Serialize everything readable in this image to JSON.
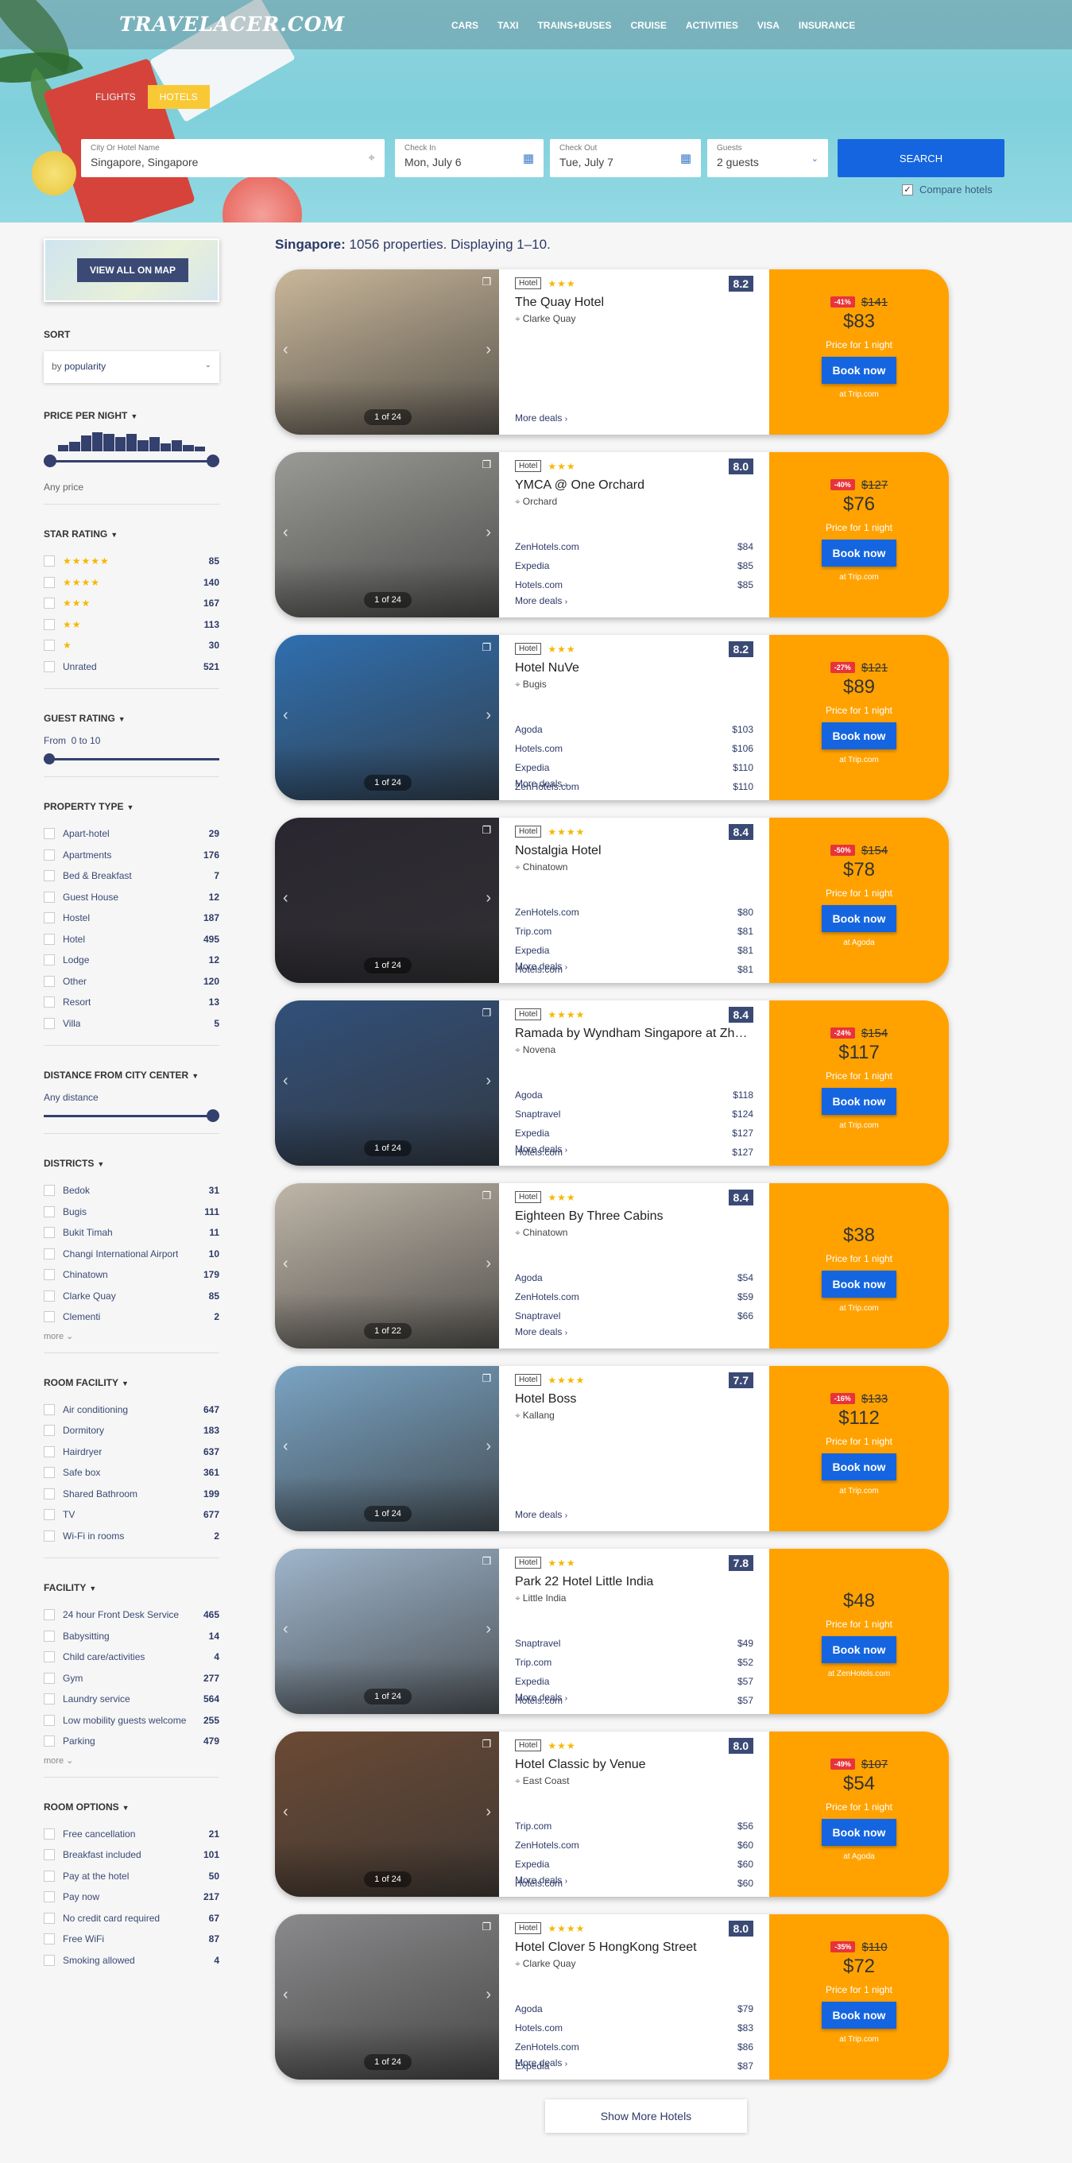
{
  "header": {
    "logo": "TRAVELACER.COM",
    "nav": [
      "CARS",
      "TAXI",
      "TRAINS+BUSES",
      "CRUISE",
      "ACTIVITIES",
      "VISA",
      "INSURANCE"
    ],
    "tabs": [
      "FLIGHTS",
      "HOTELS"
    ]
  },
  "search": {
    "city_label": "City Or Hotel Name",
    "city_value": "Singapore, Singapore",
    "checkin_label": "Check In",
    "checkin_value": "Mon, July 6",
    "checkout_label": "Check Out",
    "checkout_value": "Tue, July 7",
    "guests_label": "Guests",
    "guests_value": "2 guests",
    "search_button": "SEARCH",
    "compare_label": "Compare hotels",
    "compare_checked": true
  },
  "sidebar": {
    "map_button": "VIEW ALL ON MAP",
    "sort_title": "SORT",
    "sort_prefix": "by",
    "sort_value": "popularity",
    "price_title": "PRICE PER NIGHT",
    "price_value": "Any price",
    "star_title": "STAR RATING",
    "stars": [
      {
        "stars": "★★★★★",
        "count": "85"
      },
      {
        "stars": "★★★★",
        "count": "140"
      },
      {
        "stars": "★★★",
        "count": "167"
      },
      {
        "stars": "★★",
        "count": "113"
      },
      {
        "stars": "★",
        "count": "30"
      },
      {
        "label": "Unrated",
        "count": "521"
      }
    ],
    "guest_title": "GUEST RATING",
    "guest_from": "From",
    "guest_range": "0 to 10",
    "property_title": "PROPERTY TYPE",
    "property": [
      {
        "label": "Apart-hotel",
        "count": "29"
      },
      {
        "label": "Apartments",
        "count": "176"
      },
      {
        "label": "Bed & Breakfast",
        "count": "7"
      },
      {
        "label": "Guest House",
        "count": "12"
      },
      {
        "label": "Hostel",
        "count": "187"
      },
      {
        "label": "Hotel",
        "count": "495"
      },
      {
        "label": "Lodge",
        "count": "12"
      },
      {
        "label": "Other",
        "count": "120"
      },
      {
        "label": "Resort",
        "count": "13"
      },
      {
        "label": "Villa",
        "count": "5"
      }
    ],
    "distance_title": "DISTANCE FROM CITY CENTER",
    "distance_value": "Any distance",
    "districts_title": "DISTRICTS",
    "districts": [
      {
        "label": "Bedok",
        "count": "31"
      },
      {
        "label": "Bugis",
        "count": "111"
      },
      {
        "label": "Bukit Timah",
        "count": "11"
      },
      {
        "label": "Changi International Airport",
        "count": "10"
      },
      {
        "label": "Chinatown",
        "count": "179"
      },
      {
        "label": "Clarke Quay",
        "count": "85"
      },
      {
        "label": "Clementi",
        "count": "2"
      }
    ],
    "more": "more ⌄",
    "room_facility_title": "ROOM FACILITY",
    "room_facility": [
      {
        "label": "Air conditioning",
        "count": "647"
      },
      {
        "label": "Dormitory",
        "count": "183"
      },
      {
        "label": "Hairdryer",
        "count": "637"
      },
      {
        "label": "Safe box",
        "count": "361"
      },
      {
        "label": "Shared Bathroom",
        "count": "199"
      },
      {
        "label": "TV",
        "count": "677"
      },
      {
        "label": "Wi-Fi in rooms",
        "count": "2"
      }
    ],
    "facility_title": "FACILITY",
    "facility": [
      {
        "label": "24 hour Front Desk Service",
        "count": "465"
      },
      {
        "label": "Babysitting",
        "count": "14"
      },
      {
        "label": "Child care/activities",
        "count": "4"
      },
      {
        "label": "Gym",
        "count": "277"
      },
      {
        "label": "Laundry service",
        "count": "564"
      },
      {
        "label": "Low mobility guests welcome",
        "count": "255"
      },
      {
        "label": "Parking",
        "count": "479"
      }
    ],
    "room_options_title": "ROOM OPTIONS",
    "room_options": [
      {
        "label": "Free cancellation",
        "count": "21"
      },
      {
        "label": "Breakfast included",
        "count": "101"
      },
      {
        "label": "Pay at the hotel",
        "count": "50"
      },
      {
        "label": "Pay now",
        "count": "217"
      },
      {
        "label": "No credit card required",
        "count": "67"
      },
      {
        "label": "Free WiFi",
        "count": "87"
      },
      {
        "label": "Smoking allowed",
        "count": "4"
      }
    ]
  },
  "results": {
    "city": "Singapore:",
    "summary": "1056 properties. Displaying 1–10.",
    "more_deals": "More deals",
    "price_for": "Price for 1 night",
    "book": "Book now",
    "hotel_tag": "Hotel",
    "show_more": "Show More Hotels",
    "hotels": [
      {
        "name": "The Quay Hotel",
        "stars": "★★★",
        "score": "8.2",
        "district": "Clarke Quay",
        "photos": "1 of 24",
        "discount": "-41%",
        "old": "$141",
        "price": "$83",
        "at": "at Trip.com",
        "deals": [],
        "color": "#c9b79a"
      },
      {
        "name": "YMCA @ One Orchard",
        "stars": "★★★",
        "score": "8.0",
        "district": "Orchard",
        "photos": "1 of 24",
        "discount": "-40%",
        "old": "$127",
        "price": "$76",
        "at": "at Trip.com",
        "deals": [
          [
            "ZenHotels.com",
            "$84"
          ],
          [
            "Expedia",
            "$85"
          ],
          [
            "Hotels.com",
            "$85"
          ]
        ],
        "color": "#9a9a96"
      },
      {
        "name": "Hotel NuVe",
        "stars": "★★★",
        "score": "8.2",
        "district": "Bugis",
        "photos": "1 of 24",
        "discount": "-27%",
        "old": "$121",
        "price": "$89",
        "at": "at Trip.com",
        "deals": [
          [
            "Agoda",
            "$103"
          ],
          [
            "Hotels.com",
            "$106"
          ],
          [
            "Expedia",
            "$110"
          ],
          [
            "ZenHotels.com",
            "$110"
          ]
        ],
        "color": "#2f6fb0"
      },
      {
        "name": "Nostalgia Hotel",
        "stars": "★★★★",
        "score": "8.4",
        "district": "Chinatown",
        "photos": "1 of 24",
        "discount": "-50%",
        "old": "$154",
        "price": "$78",
        "at": "at Agoda",
        "deals": [
          [
            "ZenHotels.com",
            "$80"
          ],
          [
            "Trip.com",
            "$81"
          ],
          [
            "Expedia",
            "$81"
          ],
          [
            "Hotels.com",
            "$81"
          ]
        ],
        "color": "#2a2630"
      },
      {
        "name": "Ramada by Wyndham Singapore at Zhongshan Park",
        "stars": "★★★★",
        "score": "8.4",
        "district": "Novena",
        "photos": "1 of 24",
        "discount": "-24%",
        "old": "$154",
        "price": "$117",
        "at": "at Trip.com",
        "deals": [
          [
            "Agoda",
            "$118"
          ],
          [
            "Snaptravel",
            "$124"
          ],
          [
            "Expedia",
            "$127"
          ],
          [
            "Hotels.com",
            "$127"
          ]
        ],
        "color": "#31507a"
      },
      {
        "name": "Eighteen By Three Cabins",
        "stars": "★★★",
        "score": "8.4",
        "district": "Chinatown",
        "photos": "1 of 22",
        "discount": "",
        "old": "",
        "price": "$38",
        "at": "at Trip.com",
        "deals": [
          [
            "Agoda",
            "$54"
          ],
          [
            "ZenHotels.com",
            "$59"
          ],
          [
            "Snaptravel",
            "$66"
          ]
        ],
        "color": "#bfb6a8"
      },
      {
        "name": "Hotel Boss",
        "stars": "★★★★",
        "score": "7.7",
        "district": "Kallang",
        "photos": "1 of 24",
        "discount": "-16%",
        "old": "$133",
        "price": "$112",
        "at": "at Trip.com",
        "deals": [],
        "color": "#7aa4c4"
      },
      {
        "name": "Park 22 Hotel Little India",
        "stars": "★★★",
        "score": "7.8",
        "district": "Little India",
        "photos": "1 of 24",
        "discount": "",
        "old": "",
        "price": "$48",
        "at": "at ZenHotels.com",
        "deals": [
          [
            "Snaptravel",
            "$49"
          ],
          [
            "Trip.com",
            "$52"
          ],
          [
            "Expedia",
            "$57"
          ],
          [
            "Hotels.com",
            "$57"
          ]
        ],
        "color": "#9fb6cc"
      },
      {
        "name": "Hotel Classic by Venue",
        "stars": "★★★",
        "score": "8.0",
        "district": "East Coast",
        "photos": "1 of 24",
        "discount": "-49%",
        "old": "$107",
        "price": "$54",
        "at": "at Agoda",
        "deals": [
          [
            "Trip.com",
            "$56"
          ],
          [
            "ZenHotels.com",
            "$60"
          ],
          [
            "Expedia",
            "$60"
          ],
          [
            "Hotels.com",
            "$60"
          ]
        ],
        "color": "#6b4a34"
      },
      {
        "name": "Hotel Clover 5 HongKong Street",
        "stars": "★★★★",
        "score": "8.0",
        "district": "Clarke Quay",
        "photos": "1 of 24",
        "discount": "-35%",
        "old": "$110",
        "price": "$72",
        "at": "at Trip.com",
        "deals": [
          [
            "Agoda",
            "$79"
          ],
          [
            "Hotels.com",
            "$83"
          ],
          [
            "ZenHotels.com",
            "$86"
          ],
          [
            "Expedia",
            "$87"
          ]
        ],
        "color": "#8a8a8c"
      }
    ]
  }
}
